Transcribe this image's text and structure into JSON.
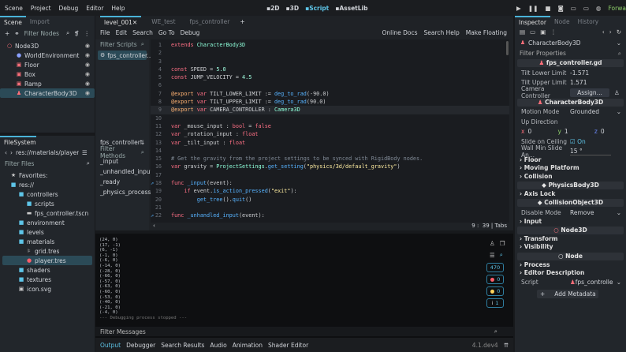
{
  "menu": [
    "Scene",
    "Project",
    "Debug",
    "Editor",
    "Help"
  ],
  "workspaces": [
    {
      "label": "2D",
      "icon": "2d-icon"
    },
    {
      "label": "3D",
      "icon": "3d-icon"
    },
    {
      "label": "Script",
      "icon": "script-icon",
      "active": true
    },
    {
      "label": "AssetLib",
      "icon": "assetlib-icon"
    }
  ],
  "renderer": "Forward+",
  "scene_dock": {
    "tabs": [
      "Scene",
      "Import"
    ],
    "filter_placeholder": "Filter Nodes",
    "nodes": [
      {
        "name": "Node3D",
        "icon": "○",
        "color": "#ff6f7a",
        "depth": 0
      },
      {
        "name": "WorldEnvironment",
        "icon": "●",
        "color": "#8aa0ff",
        "depth": 1
      },
      {
        "name": "Floor",
        "icon": "▣",
        "color": "#ff6f7a",
        "depth": 1
      },
      {
        "name": "Box",
        "icon": "▣",
        "color": "#ff6f7a",
        "depth": 1
      },
      {
        "name": "Ramp",
        "icon": "▣",
        "color": "#ff6f7a",
        "depth": 1
      },
      {
        "name": "CharacterBody3D",
        "icon": "♟",
        "color": "#ff6f7a",
        "depth": 1,
        "selected": true
      }
    ]
  },
  "filesystem": {
    "title": "FileSystem",
    "path": "res://materials/player.tre",
    "filter_placeholder": "Filter Files",
    "items": [
      {
        "name": "Favorites:",
        "icon": "★",
        "d": 0
      },
      {
        "name": "res://",
        "icon": "■",
        "d": 0
      },
      {
        "name": "controllers",
        "icon": "■",
        "d": 1
      },
      {
        "name": "scripts",
        "icon": "■",
        "d": 2
      },
      {
        "name": "fps_controller.tscn",
        "icon": "▬",
        "d": 2
      },
      {
        "name": "environment",
        "icon": "■",
        "d": 1
      },
      {
        "name": "levels",
        "icon": "■",
        "d": 1
      },
      {
        "name": "materials",
        "icon": "■",
        "d": 1
      },
      {
        "name": "grid.tres",
        "icon": "⊧",
        "d": 2
      },
      {
        "name": "player.tres",
        "icon": "●",
        "d": 2,
        "selected": true
      },
      {
        "name": "shaders",
        "icon": "■",
        "d": 1
      },
      {
        "name": "textures",
        "icon": "■",
        "d": 1
      },
      {
        "name": "icon.svg",
        "icon": "▣",
        "d": 1
      }
    ]
  },
  "scene_tabs": [
    {
      "label": "level_001",
      "active": true
    },
    {
      "label": "WE_test"
    },
    {
      "label": "fps_controller"
    }
  ],
  "script_menu": [
    "File",
    "Edit",
    "Search",
    "Go To",
    "Debug"
  ],
  "script_links": [
    "Online Docs",
    "Search Help",
    "Make Floating"
  ],
  "scripts_filter": "Filter Scripts",
  "open_script": "fps_controller...",
  "methods_file": "fps_controller.g",
  "methods_filter": "Filter Methods",
  "methods": [
    "_input",
    "_unhandled_input",
    "_ready",
    "_physics_process"
  ],
  "code": [
    [
      [
        "extends ",
        "kw"
      ],
      [
        "CharacterBody3D",
        "ty"
      ]
    ],
    [],
    [],
    [
      [
        "const ",
        "kw"
      ],
      [
        "SPEED = ",
        "pl"
      ],
      [
        "5.0",
        "nu"
      ]
    ],
    [
      [
        "const ",
        "kw"
      ],
      [
        "JUMP_VELOCITY = ",
        "pl"
      ],
      [
        "4.5",
        "nu"
      ]
    ],
    [],
    [
      [
        "@export ",
        "an"
      ],
      [
        "var ",
        "kw"
      ],
      [
        "TILT_LOWER_LIMIT := ",
        "pl"
      ],
      [
        "deg_to_rad",
        "fn"
      ],
      [
        "(-90.0)",
        "pl"
      ]
    ],
    [
      [
        "@export ",
        "an"
      ],
      [
        "var ",
        "kw"
      ],
      [
        "TILT_UPPER_LIMIT := ",
        "pl"
      ],
      [
        "deg_to_rad",
        "fn"
      ],
      [
        "(90.0)",
        "pl"
      ]
    ],
    [
      [
        "@export ",
        "an"
      ],
      [
        "var ",
        "kw"
      ],
      [
        "CAMERA_CONTROLLER : ",
        "pl"
      ],
      [
        "Camera3D",
        "ty"
      ]
    ],
    [],
    [
      [
        "var ",
        "kw"
      ],
      [
        "_mouse_input : ",
        "pl"
      ],
      [
        "bool",
        "kw"
      ],
      [
        " = ",
        "pl"
      ],
      [
        "false",
        "kw"
      ]
    ],
    [
      [
        "var ",
        "kw"
      ],
      [
        "_rotation_input : ",
        "pl"
      ],
      [
        "float",
        "kw"
      ]
    ],
    [
      [
        "var ",
        "kw"
      ],
      [
        "_tilt_input : ",
        "pl"
      ],
      [
        "float",
        "kw"
      ]
    ],
    [],
    [
      [
        "# Get the gravity from the project settings to be synced with RigidBody nodes.",
        "cm"
      ]
    ],
    [
      [
        "var ",
        "kw"
      ],
      [
        "gravity = ",
        "pl"
      ],
      [
        "ProjectSettings",
        "ty"
      ],
      [
        ".",
        "pl"
      ],
      [
        "get_setting",
        "fn"
      ],
      [
        "(",
        "pl"
      ],
      [
        "\"physics/3d/default_gravity\"",
        "st"
      ],
      [
        ")",
        "pl"
      ]
    ],
    [],
    [
      [
        "func ",
        "kw"
      ],
      [
        "_input",
        "fn"
      ],
      [
        "(event):",
        "pl"
      ]
    ],
    [
      [
        "    if ",
        "kw"
      ],
      [
        "event.",
        "pl"
      ],
      [
        "is_action_pressed",
        "fn"
      ],
      [
        "(",
        "pl"
      ],
      [
        "\"exit\"",
        "st"
      ],
      [
        "):",
        "pl"
      ]
    ],
    [
      [
        "        get_tree",
        "fn"
      ],
      [
        "().",
        "pl"
      ],
      [
        "quit",
        "fn"
      ],
      [
        "()",
        "pl"
      ]
    ],
    [],
    [
      [
        "func ",
        "kw"
      ],
      [
        "_unhandled_input",
        "fn"
      ],
      [
        "(event):",
        "pl"
      ]
    ]
  ],
  "cursor": {
    "line": "9",
    "col": "39",
    "indent": "Tabs"
  },
  "output_lines": [
    "(24, 0)",
    "(17, -1)",
    "(6, -1)",
    "(-1, 0)",
    "(-6, 0)",
    "(-14, 0)",
    "(-28, 0)",
    "(-66, 0)",
    "(-57, 0)",
    "(-63, 0)",
    "(-60, 0)",
    "(-53, 0)",
    "(-40, 0)",
    "(-21, 0)",
    "(-4, 0)",
    "--- Debugging process stopped ---"
  ],
  "output_filter": "Filter Messages",
  "counts": {
    "messages": "470",
    "errors": "0",
    "warnings": "0",
    "info": "1"
  },
  "bottom_tabs": [
    "Output",
    "Debugger",
    "Search Results",
    "Audio",
    "Animation",
    "Shader Editor"
  ],
  "version": "4.1.dev4",
  "inspector": {
    "tabs": [
      "Inspector",
      "Node",
      "History"
    ],
    "node": "CharacterBody3D",
    "filter": "Filter Properties",
    "script_section": "fps_controller.gd",
    "tilt_lower_label": "Tilt Lower Limit",
    "tilt_lower": "-1.571",
    "tilt_upper_label": "Tilt Upper Limit",
    "tilt_upper": "1.571",
    "camera_label": "Camera Controller",
    "assign": "Assign...",
    "body_section": "CharacterBody3D",
    "motion_label": "Motion Mode",
    "motion": "Grounded",
    "up_label": "Up Direction",
    "up": {
      "x": "0",
      "y": "1",
      "z": "0"
    },
    "slide_label": "Slide on Ceiling",
    "slide": "On",
    "wall_label": "Wall Min Slide An...",
    "wall": "15",
    "wall_unit": "°",
    "groups1": [
      "Floor",
      "Moving Platform",
      "Collision"
    ],
    "physics_section": "PhysicsBody3D",
    "axis_lock": "Axis Lock",
    "collision_section": "CollisionObject3D",
    "disable_label": "Disable Mode",
    "disable": "Remove",
    "input": "Input",
    "node3d_section": "Node3D",
    "groups2": [
      "Transform",
      "Visibility"
    ],
    "node_section": "Node",
    "groups3": [
      "Process",
      "Editor Description"
    ],
    "script_label": "Script",
    "script_value": "fps_controlle",
    "add_meta": "Add Metadata"
  }
}
